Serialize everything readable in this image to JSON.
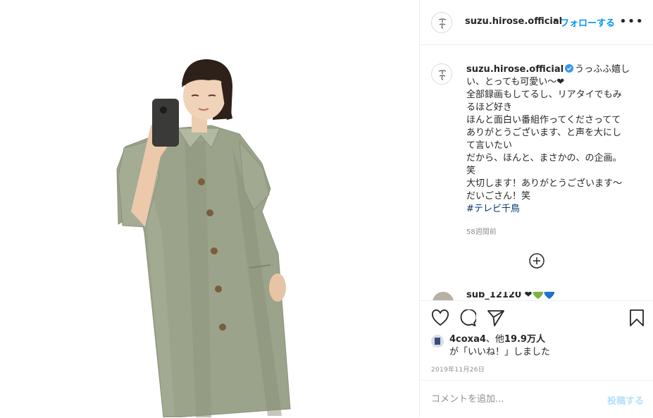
{
  "post": {
    "photo_alt": "selfie in long sage-green coat",
    "icon": "photo"
  },
  "header": {
    "username": "suzu.hirose.official",
    "separator": "•",
    "follow_label": "フォローする",
    "more_label": "•••"
  },
  "caption": {
    "username": "suzu.hirose.official",
    "lines": [
      "うっふふ嬉し",
      "い、とっても可愛い〜❤︎",
      "全部録画もしてるし、リアタイでもみ",
      "るほど好き",
      "ほんと面白い番組作ってくださってて",
      "ありがとうございます、と声を大にし",
      "て言いたい",
      "だから、ほんと、まさかの、の企画。",
      "笑",
      "大切します！ありがとうございます〜",
      "だいごさん！笑"
    ],
    "hashtag": "#テレビ千鳥",
    "time_ago": "58週間前"
  },
  "next_comment": {
    "text": "sub_12120 ❤💚💙"
  },
  "likes": {
    "liker": "4coxa4",
    "joiner": "、他",
    "count": "19.9万人",
    "suffix": "が「いいね！」しました"
  },
  "date": "2019年11月26日",
  "comment": {
    "placeholder": "コメントを追加...",
    "post_label": "投稿する"
  },
  "colors": {
    "accent": "#0095f6",
    "text": "#262626",
    "muted": "#8e8e8e",
    "coat": "#9aa28a",
    "hashtag": "#00376b"
  }
}
